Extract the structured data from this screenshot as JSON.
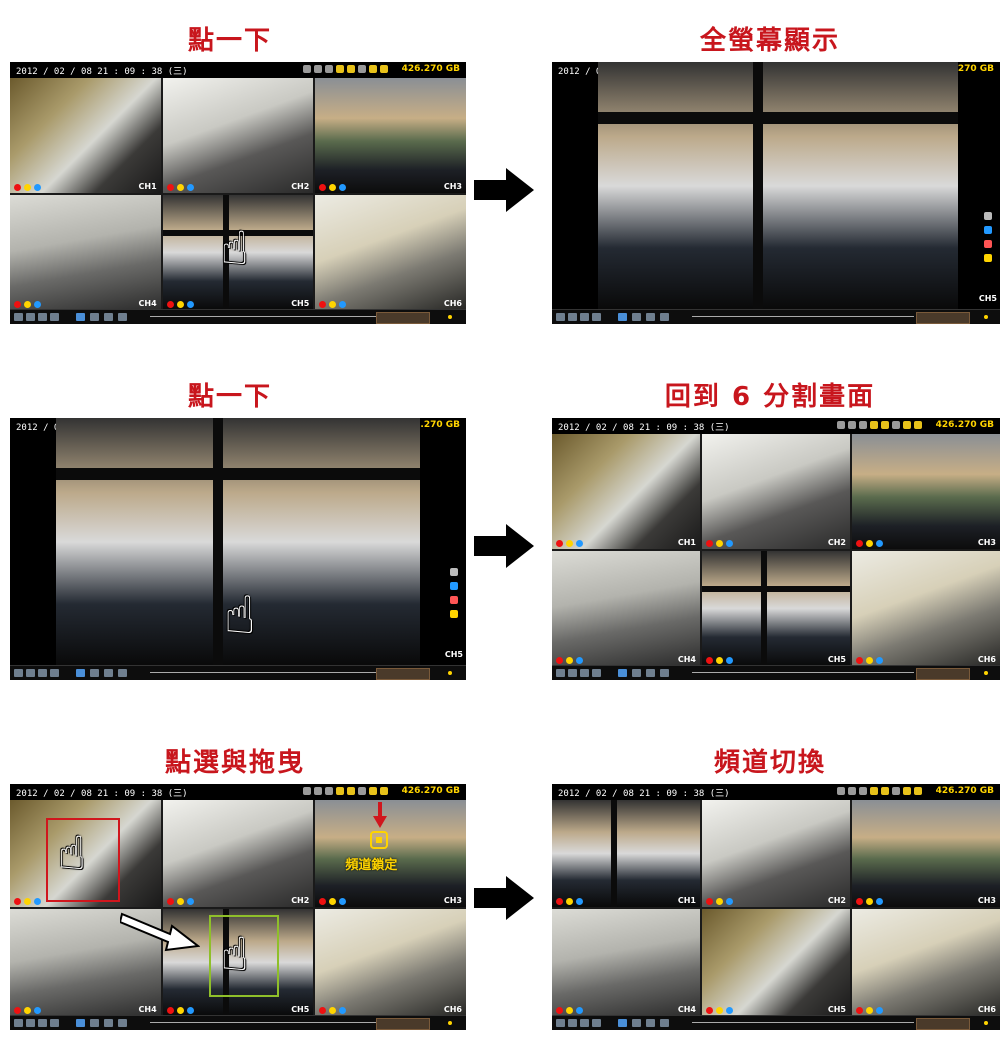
{
  "titles": {
    "row1_left": "點一下",
    "row1_right": "全螢幕顯示",
    "row2_left": "點一下",
    "row2_right": "回到 6 分割畫面",
    "row3_left": "點選與拖曳",
    "row3_right": "頻道切換"
  },
  "screen": {
    "timestamp": "2012 / 02 / 08  21 : 09 : 38 (三)",
    "hdd_space": "426.270 GB",
    "channels": [
      "CH1",
      "CH2",
      "CH3",
      "CH4",
      "CH5",
      "CH6"
    ],
    "fullscreen_channel": "CH5"
  },
  "annotations": {
    "channel_lock": "頻道鎖定"
  },
  "colors": {
    "title_red": "#c8161d",
    "hdd_yellow": "#ffd400",
    "select_red": "#d0161d",
    "select_green": "#8fbf2a"
  }
}
